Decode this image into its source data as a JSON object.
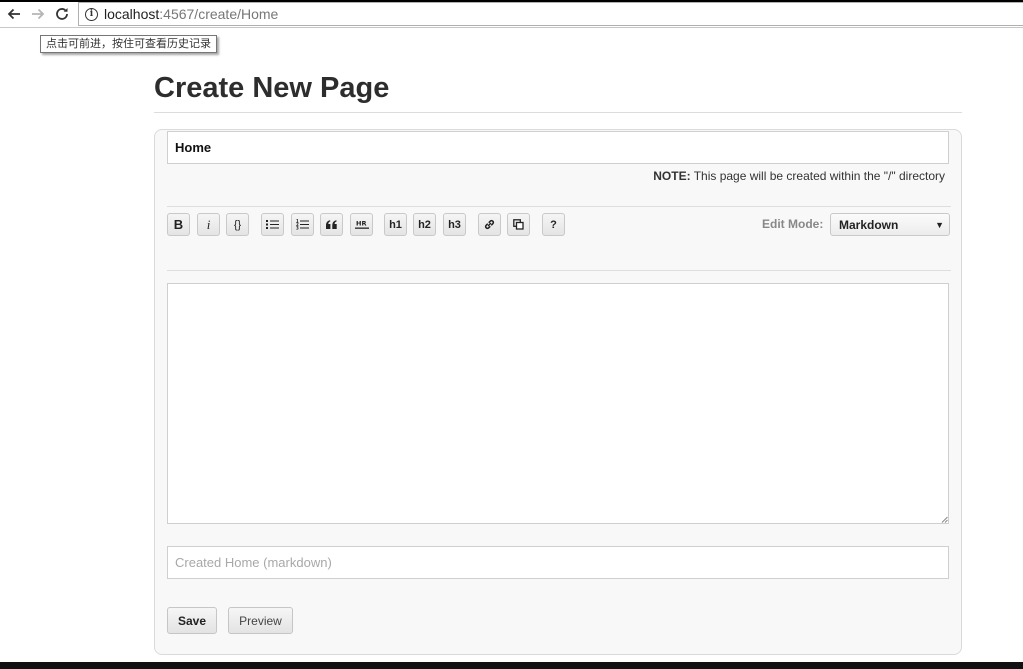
{
  "browser": {
    "url_host": "localhost",
    "url_rest": ":4567/create/Home",
    "tooltip": "点击可前进，按住可查看历史记录"
  },
  "page": {
    "title": "Create New Page"
  },
  "form": {
    "page_name_value": "Home",
    "note_label": "NOTE:",
    "note_text": " This page will be created within the \"/\" directory",
    "edit_mode_label": "Edit Mode:",
    "edit_mode_value": "Markdown",
    "content_value": "",
    "message_placeholder": "Created Home (markdown)",
    "save_label": "Save",
    "preview_label": "Preview"
  },
  "toolbar": {
    "bold": "B",
    "italic": "i",
    "code": "{}",
    "h1": "h1",
    "h2": "h2",
    "h3": "h3",
    "help": "?"
  },
  "colors": {
    "panel_bg": "#f8f8f8",
    "title": "#2d2d2d",
    "label_muted": "#888888"
  }
}
